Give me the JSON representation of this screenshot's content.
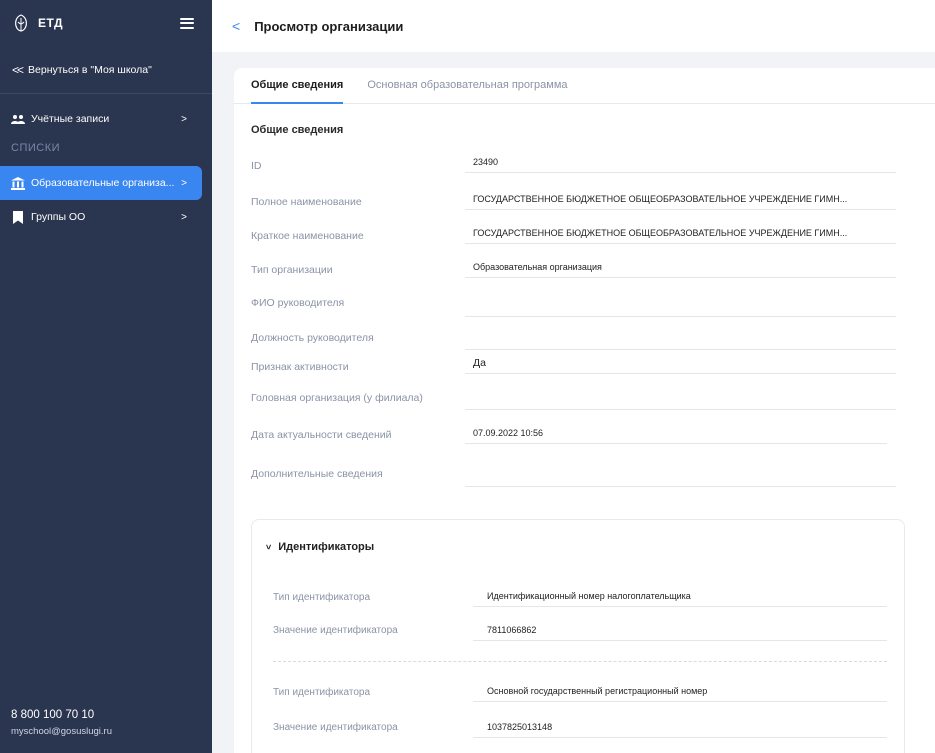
{
  "sidebar": {
    "logo_text": "ЕТД",
    "back_label": "Вернуться в \"Моя школа\"",
    "items": [
      {
        "label": "Учётные записи"
      },
      {
        "label": "Образовательные организа..."
      },
      {
        "label": "Группы ОО"
      }
    ],
    "section_label": "СПИСКИ",
    "phone": "8 800 100 70 10",
    "email": "myschool@gosuslugi.ru"
  },
  "header": {
    "title": "Просмотр организации"
  },
  "tabs": [
    {
      "label": "Общие сведения",
      "active": true
    },
    {
      "label": "Основная образовательная программа",
      "active": false
    }
  ],
  "general": {
    "section_title": "Общие сведения",
    "fields": [
      {
        "label": "ID",
        "value": "23490"
      },
      {
        "label": "Полное наименование",
        "value": "ГОСУДАРСТВЕННОЕ БЮДЖЕТНОЕ ОБЩЕОБРАЗОВАТЕЛЬНОЕ УЧРЕЖДЕНИЕ ГИМН..."
      },
      {
        "label": "Краткое наименование",
        "value": "ГОСУДАРСТВЕННОЕ БЮДЖЕТНОЕ ОБЩЕОБРАЗОВАТЕЛЬНОЕ УЧРЕЖДЕНИЕ ГИМН..."
      },
      {
        "label": "Тип организации",
        "value": "Образовательная организация"
      },
      {
        "label": "ФИО руководителя",
        "value": ""
      },
      {
        "label": "Должность руководителя",
        "value": ""
      },
      {
        "label": "Признак активности",
        "value": "Да"
      },
      {
        "label": "Головная организация (у филиала)",
        "value": ""
      },
      {
        "label": "Дата актуальности сведений",
        "value": "07.09.2022 10:56"
      },
      {
        "label": "Дополнительные сведения",
        "value": ""
      }
    ]
  },
  "identifiers": {
    "title": "Идентификаторы",
    "groups": [
      {
        "type_label": "Тип идентификатора",
        "type_value": "Идентификационный номер налогоплательщика",
        "value_label": "Значение идентификатора",
        "value": "7811066862"
      },
      {
        "type_label": "Тип идентификатора",
        "type_value": "Основной государственный регистрационный номер",
        "value_label": "Значение идентификатора",
        "value": "1037825013148"
      }
    ]
  },
  "colors": {
    "sidebar_bg": "#2a3550",
    "accent": "#3a86f0"
  }
}
